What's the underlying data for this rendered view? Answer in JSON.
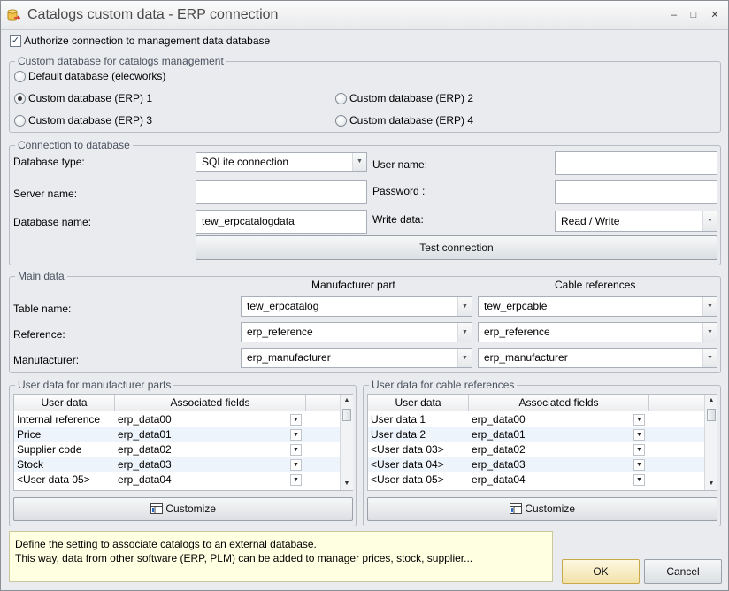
{
  "window": {
    "title": "Catalogs custom data - ERP connection",
    "minimize": "–",
    "maximize": "□",
    "close": "✕"
  },
  "authorize": {
    "label": "Authorize connection to management data database",
    "checked": "✓"
  },
  "custom_db": {
    "title": "Custom database for catalogs management",
    "options": [
      {
        "label": "Default database (elecworks)"
      },
      {
        "label": "Custom database (ERP) 1"
      },
      {
        "label": "Custom database (ERP) 2"
      },
      {
        "label": "Custom database (ERP) 3"
      },
      {
        "label": "Custom database (ERP) 4"
      }
    ]
  },
  "connection": {
    "title": "Connection to database",
    "db_type_label": "Database type:",
    "db_type_value": "SQLite connection",
    "user_name_label": "User name:",
    "user_name_value": "",
    "server_name_label": "Server name:",
    "server_name_value": "",
    "password_label": "Password :",
    "password_value": "",
    "db_name_label": "Database name:",
    "db_name_value": "tew_erpcatalogdata",
    "write_data_label": "Write data:",
    "write_data_value": "Read / Write",
    "test_button": "Test connection"
  },
  "main_data": {
    "title": "Main data",
    "col_manufacturer": "Manufacturer part",
    "col_cable": "Cable references",
    "rows": [
      {
        "label": "Table name:",
        "manufacturer": "tew_erpcatalog",
        "cable": "tew_erpcable"
      },
      {
        "label": "Reference:",
        "manufacturer": "erp_reference",
        "cable": "erp_reference"
      },
      {
        "label": "Manufacturer:",
        "manufacturer": "erp_manufacturer",
        "cable": "erp_manufacturer"
      }
    ]
  },
  "user_parts": {
    "title": "User data for manufacturer parts",
    "col_user": "User data",
    "col_fields": "Associated fields",
    "rows": [
      {
        "user": "Internal reference",
        "field": "erp_data00"
      },
      {
        "user": "Price",
        "field": "erp_data01"
      },
      {
        "user": "Supplier code",
        "field": "erp_data02"
      },
      {
        "user": "Stock",
        "field": "erp_data03"
      },
      {
        "user": "<User data 05>",
        "field": "erp_data04"
      }
    ],
    "customize": "Customize"
  },
  "user_cables": {
    "title": "User data for cable references",
    "col_user": "User data",
    "col_fields": "Associated fields",
    "rows": [
      {
        "user": "User data 1",
        "field": "erp_data00"
      },
      {
        "user": "User data 2",
        "field": "erp_data01"
      },
      {
        "user": "<User data 03>",
        "field": "erp_data02"
      },
      {
        "user": "<User data 04>",
        "field": "erp_data03"
      },
      {
        "user": "<User data 05>",
        "field": "erp_data04"
      }
    ],
    "customize": "Customize"
  },
  "info": {
    "line1": "Define the setting to associate catalogs to an external database.",
    "line2": "This way, data from other software (ERP, PLM) can be added to manager prices, stock, supplier..."
  },
  "ok_button": "OK",
  "cancel_button": "Cancel",
  "colors": {
    "info_bg": "#ffffe1",
    "window_bg": "#e9ebee",
    "accent_row": "#eef4fb"
  }
}
